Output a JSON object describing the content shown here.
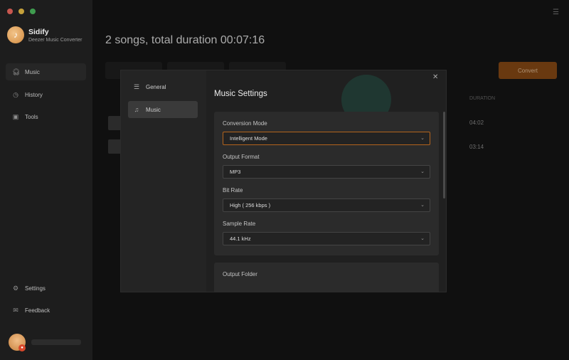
{
  "app": {
    "name": "Sidify",
    "subtitle": "Deezer Music Converter"
  },
  "sidebar": {
    "items": [
      {
        "label": "Music",
        "icon": "headphones-icon"
      },
      {
        "label": "History",
        "icon": "clock-icon"
      },
      {
        "label": "Tools",
        "icon": "toolbox-icon"
      }
    ],
    "bottom": [
      {
        "label": "Settings",
        "icon": "gear-icon"
      },
      {
        "label": "Feedback",
        "icon": "mail-icon"
      }
    ]
  },
  "main": {
    "title": "2 songs, total duration 00:07:16",
    "convert_label": "Convert",
    "duration_header": "DURATION",
    "durations": [
      "04:02",
      "03:14"
    ]
  },
  "dialog": {
    "nav": [
      {
        "label": "General",
        "icon": "sliders-icon"
      },
      {
        "label": "Music",
        "icon": "music-note-icon"
      }
    ],
    "title": "Music Settings",
    "fields": {
      "conversion_mode": {
        "label": "Conversion Mode",
        "value": "Intelligent Mode"
      },
      "output_format": {
        "label": "Output Format",
        "value": "MP3"
      },
      "bit_rate": {
        "label": "Bit Rate",
        "value": "High ( 256 kbps )"
      },
      "sample_rate": {
        "label": "Sample Rate",
        "value": "44.1 kHz"
      }
    },
    "output_folder_label": "Output Folder"
  },
  "colors": {
    "accent": "#b4641c",
    "convert_bg": "#8d4d16"
  }
}
